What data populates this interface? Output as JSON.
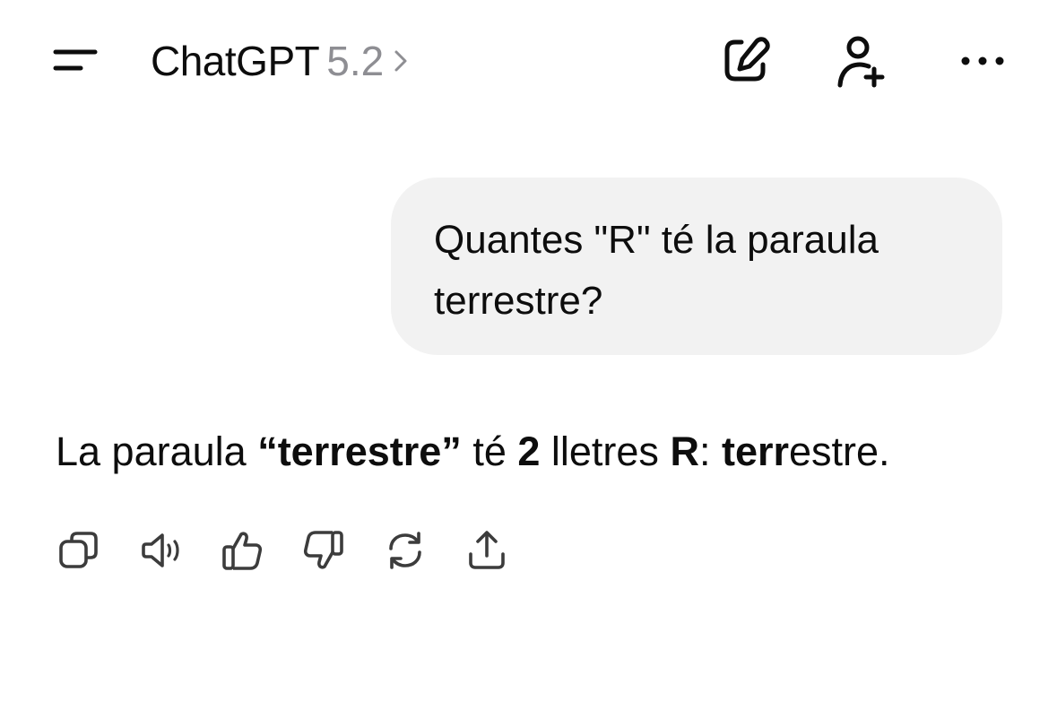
{
  "header": {
    "app_name": "ChatGPT",
    "version": "5.2",
    "icons": [
      "menu-icon",
      "chevron-right-icon",
      "new-chat-icon",
      "add-person-icon",
      "more-icon"
    ]
  },
  "conversation": {
    "user_message": {
      "line1": "Quantes \"R\" té la paraula",
      "line2": "terrestre?"
    },
    "assistant_message": {
      "prefix": "La paraula ",
      "word_quoted": "“terrestre”",
      "mid1": " té ",
      "count": "2",
      "mid2": " lletres ",
      "letter": "R",
      "colon": ": ",
      "seg1_bold": "te",
      "seg2_bold_r": "rr",
      "seg3_plain": "estre."
    },
    "action_icons": [
      "copy-icon",
      "read-aloud-icon",
      "thumbs-up-icon",
      "thumbs-down-icon",
      "regenerate-icon",
      "share-icon"
    ]
  },
  "colors": {
    "background": "#ffffff",
    "text": "#0d0d0d",
    "muted": "#8e8e93",
    "bubble": "#f2f2f2"
  }
}
